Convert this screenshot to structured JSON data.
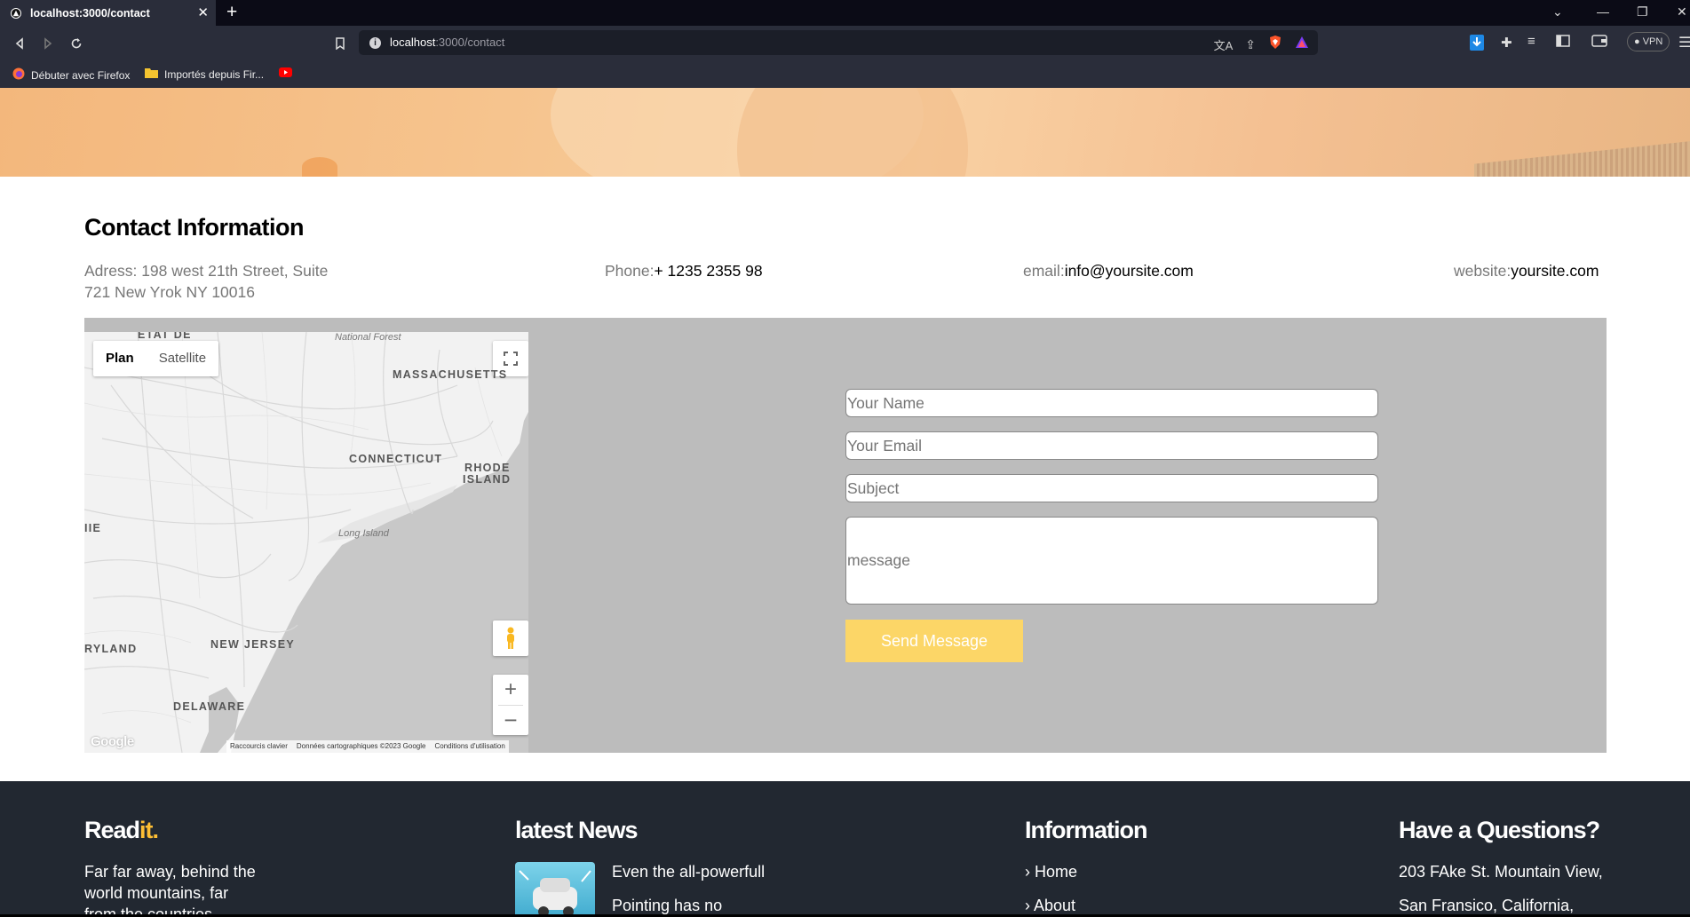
{
  "browser": {
    "tab_title": "localhost:3000/contact",
    "url_host": "localhost",
    "url_path": ":3000/contact",
    "bookmarks": [
      {
        "label": "Débuter avec Firefox",
        "icon": "firefox-icon"
      },
      {
        "label": "Importés depuis Fir...",
        "icon": "folder-icon"
      },
      {
        "label": "",
        "icon": "youtube-icon"
      }
    ],
    "vpn_label": "VPN"
  },
  "contact": {
    "title": "Contact Information",
    "address_label": "Adress: 198 west 21th Street, Suite",
    "address_line2": "721 New Yrok NY 10016",
    "phone_label": "Phone:",
    "phone_value": "+ 1235 2355 98",
    "email_label": "email:",
    "email_value": "info@yoursite.com",
    "website_label": "website:",
    "website_value": "yoursite.com"
  },
  "map": {
    "type_plan": "Plan",
    "type_satellite": "Satellite",
    "labels": {
      "etat": "ÉTAT DE",
      "forest": "National Forest",
      "mass": "MASSACHUSETTS",
      "conn": "CONNECTICUT",
      "rhode1": "RHODE",
      "rhode2": "ISLAND",
      "ie": "IIE",
      "longisland": "Long Island",
      "ryland": "RYLAND",
      "newjersey": "NEW JERSEY",
      "delaware": "DELAWARE"
    },
    "footer": {
      "shortcuts": "Raccourcis clavier",
      "data": "Données cartographiques ©2023 Google",
      "terms": "Conditions d'utilisation"
    },
    "google": "Google"
  },
  "form": {
    "name_placeholder": "Your Name",
    "email_placeholder": "Your Email",
    "subject_placeholder": "Subject",
    "message_placeholder": "message",
    "send_label": "Send Message"
  },
  "footer": {
    "brand_main": "Read",
    "brand_accent": "it.",
    "about_text": [
      "Far far away, behind the",
      "world mountains, far",
      "from the countries"
    ],
    "news_title": "latest News",
    "news_items": [
      "Even the all-powerfull",
      "Pointing has no"
    ],
    "info_title": "Information",
    "info_links": [
      "Home",
      "About"
    ],
    "questions_title": "Have a Questions?",
    "address_lines": [
      "203 FAke St. Mountain View,",
      "San Fransico, California,"
    ]
  }
}
